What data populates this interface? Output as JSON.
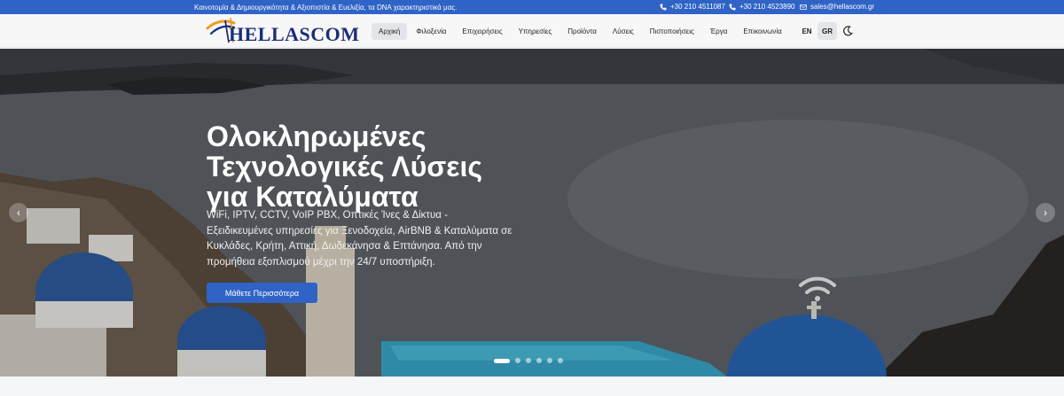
{
  "topbar": {
    "tagline": "Καινοτομία & Δημιουργικότητα & Αξιοπιστία & Ευελιξία, τα DNA χαρακτηριστικά μας.",
    "phone1": "+30 210 4511087",
    "phone2": "+30 210 4523890",
    "email": "sales@hellascom.gr"
  },
  "nav": {
    "logo_text": "HELLASCOM",
    "items": [
      {
        "label": "Αρχική",
        "active": true
      },
      {
        "label": "Φιλοξενία"
      },
      {
        "label": "Επιχειρήσεις"
      },
      {
        "label": "Υπηρεσίες"
      },
      {
        "label": "Προϊόντα"
      },
      {
        "label": "Λύσεις"
      },
      {
        "label": "Πιστοποιήσεις"
      },
      {
        "label": "Έργα"
      },
      {
        "label": "Επικοινωνία"
      }
    ],
    "lang_en": "EN",
    "lang_gr": "GR"
  },
  "hero": {
    "title_lines": [
      "Ολοκληρωμένες",
      "Τεχνολογικές Λύσεις",
      "για Καταλύματα"
    ],
    "subtitle": "WiFi, IPTV, CCTV, VoIP PBX, Οπτικές Ίνες & Δίκτυα - Εξειδικευμένες υπηρεσίες για Ξενοδοχεία, AirBNB & Καταλύματα σε Κυκλάδες, Κρήτη, Αττική, Δωδεκάνησα & Επτάνησα. Από την προμήθεια εξοπλισμού μέχρι την 24/7 υποστήριξη.",
    "cta": "Μάθετε Περισσότερα",
    "slides": 6,
    "active_slide": 0
  },
  "colors": {
    "brand_blue": "#2f63c6",
    "logo_navy": "#1b2f77",
    "logo_orange": "#f39a1e"
  }
}
